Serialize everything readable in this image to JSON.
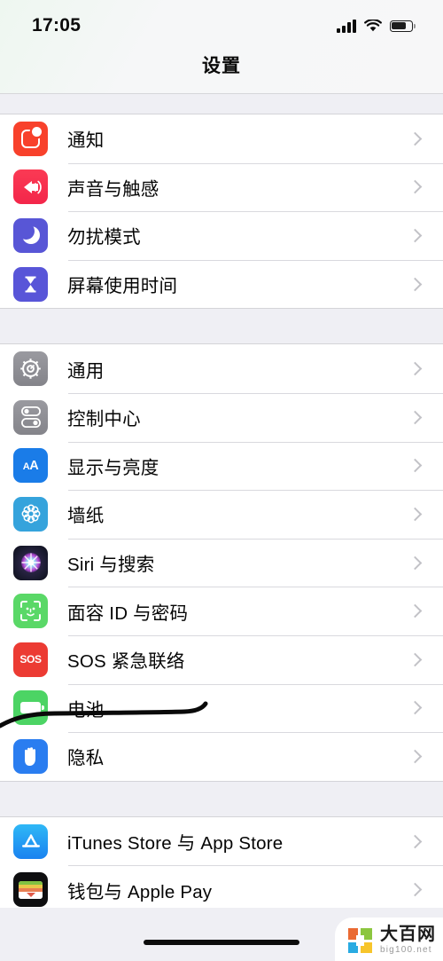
{
  "status_bar": {
    "time": "17:05",
    "signal_icon": "cellular-signal-icon",
    "wifi_icon": "wifi-icon",
    "battery_icon": "battery-icon",
    "battery_level": 65
  },
  "nav": {
    "title": "设置"
  },
  "groups": [
    {
      "id": "group-alerts",
      "rows": [
        {
          "label": "通知",
          "icon": "notifications-icon",
          "icon_class": "ic-notify"
        },
        {
          "label": "声音与触感",
          "icon": "sounds-haptics-icon",
          "icon_class": "ic-sound"
        },
        {
          "label": "勿扰模式",
          "icon": "do-not-disturb-icon",
          "icon_class": "ic-dnd"
        },
        {
          "label": "屏幕使用时间",
          "icon": "screen-time-icon",
          "icon_class": "ic-screentime"
        }
      ]
    },
    {
      "id": "group-system",
      "rows": [
        {
          "label": "通用",
          "icon": "general-gear-icon",
          "icon_class": "ic-general"
        },
        {
          "label": "控制中心",
          "icon": "control-center-icon",
          "icon_class": "ic-control"
        },
        {
          "label": "显示与亮度",
          "icon": "display-brightness-icon",
          "icon_class": "ic-display"
        },
        {
          "label": "墙纸",
          "icon": "wallpaper-icon",
          "icon_class": "ic-wallpaper"
        },
        {
          "label": "Siri 与搜索",
          "icon": "siri-search-icon",
          "icon_class": "ic-siri"
        },
        {
          "label": "面容 ID 与密码",
          "icon": "face-id-icon",
          "icon_class": "ic-faceid"
        },
        {
          "label": "SOS 紧急联络",
          "icon": "emergency-sos-icon",
          "icon_class": "ic-sos"
        },
        {
          "label": "电池",
          "icon": "battery-settings-icon",
          "icon_class": "ic-battery"
        },
        {
          "label": "隐私",
          "icon": "privacy-hand-icon",
          "icon_class": "ic-privacy"
        }
      ]
    },
    {
      "id": "group-store",
      "rows": [
        {
          "label": "iTunes Store 与 App Store",
          "icon": "app-store-icon",
          "icon_class": "ic-appstore"
        },
        {
          "label": "钱包与 Apple Pay",
          "icon": "wallet-icon",
          "icon_class": "ic-wallet"
        }
      ]
    }
  ],
  "annotation": {
    "type": "hand-drawn-underline",
    "target_label": "电池",
    "color": "#000000"
  },
  "watermark": {
    "name_cn": "大百网",
    "name_en": "big100.net",
    "colors": [
      "#ea6a33",
      "#8cc63f",
      "#29abe2",
      "#f7c52b"
    ]
  },
  "home_indicator": "home-indicator"
}
